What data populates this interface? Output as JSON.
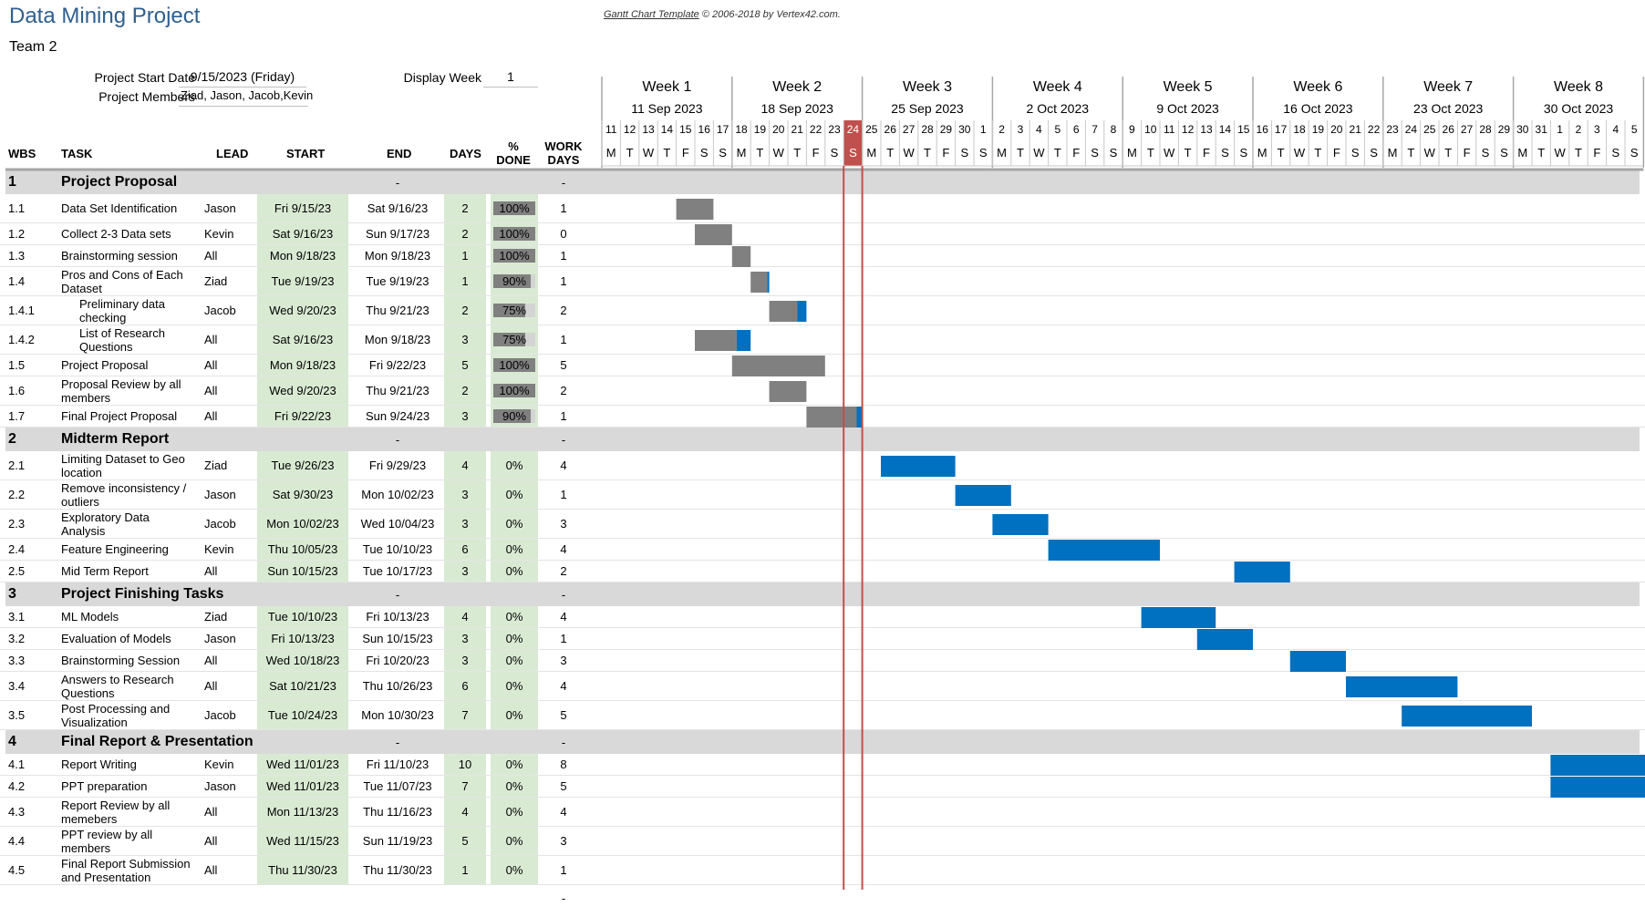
{
  "header": {
    "title": "Data Mining Project",
    "team": "Team 2",
    "credit_link": "Gantt Chart Template",
    "credit_rest": "© 2006-2018 by Vertex42.com."
  },
  "project": {
    "start_label": "Project Start Date",
    "start_value": "9/15/2023 (Friday)",
    "members_label": "Project Members",
    "members_value": "Ziad, Jason, Jacob,Kevin",
    "display_week_label": "Display Week",
    "display_week_value": "1"
  },
  "columns": {
    "wbs": "WBS",
    "task": "TASK",
    "lead": "LEAD",
    "start": "START",
    "end": "END",
    "days": "DAYS",
    "pct_done_1": "%",
    "pct_done_2": "DONE",
    "work_days_1": "WORK",
    "work_days_2": "DAYS"
  },
  "weeks": [
    {
      "label": "Week 1",
      "date": "11 Sep 2023"
    },
    {
      "label": "Week 2",
      "date": "18 Sep 2023"
    },
    {
      "label": "Week 3",
      "date": "25 Sep 2023"
    },
    {
      "label": "Week 4",
      "date": "2 Oct 2023"
    },
    {
      "label": "Week 5",
      "date": "9 Oct 2023"
    },
    {
      "label": "Week 6",
      "date": "16 Oct 2023"
    },
    {
      "label": "Week 7",
      "date": "23 Oct 2023"
    },
    {
      "label": "Week 8",
      "date": "30 Oct 2023"
    }
  ],
  "day_numbers": [
    "11",
    "12",
    "13",
    "14",
    "15",
    "16",
    "17",
    "18",
    "19",
    "20",
    "21",
    "22",
    "23",
    "24",
    "25",
    "26",
    "27",
    "28",
    "29",
    "30",
    "1",
    "2",
    "3",
    "4",
    "5",
    "6",
    "7",
    "8",
    "9",
    "10",
    "11",
    "12",
    "13",
    "14",
    "15",
    "16",
    "17",
    "18",
    "19",
    "20",
    "21",
    "22",
    "23",
    "24",
    "25",
    "26",
    "27",
    "28",
    "29",
    "30",
    "31",
    "1",
    "2",
    "3",
    "4",
    "5"
  ],
  "day_letters": [
    "M",
    "T",
    "W",
    "T",
    "F",
    "S",
    "S"
  ],
  "today_index": 13,
  "colors": {
    "title": "#2F5F8F",
    "bar_done": "#808080",
    "bar_todo": "#0070C0",
    "today": "#C0504D",
    "phase_band": "#D9D9D9",
    "green_cell": "#D9EAD3"
  },
  "phases": [
    {
      "wbs": "1",
      "name": "Project Proposal",
      "end": "-",
      "work_days": "-",
      "tasks": [
        {
          "wbs": "1.1",
          "task": "Data Set Identification",
          "lead": "Jason",
          "start": "Fri 9/15/23",
          "end": "Sat 9/16/23",
          "days": "2",
          "pct": "100%",
          "pct_value": 1.0,
          "work_days": "1",
          "bar": {
            "start": 4,
            "len": 2
          }
        },
        {
          "wbs": "1.2",
          "task": "Collect 2-3 Data sets",
          "lead": "Kevin",
          "start": "Sat 9/16/23",
          "end": "Sun 9/17/23",
          "days": "2",
          "pct": "100%",
          "pct_value": 1.0,
          "work_days": "0",
          "bar": {
            "start": 5,
            "len": 2
          }
        },
        {
          "wbs": "1.3",
          "task": "Brainstorming session",
          "lead": "All",
          "start": "Mon 9/18/23",
          "end": "Mon 9/18/23",
          "days": "1",
          "pct": "100%",
          "pct_value": 1.0,
          "work_days": "1",
          "bar": {
            "start": 7,
            "len": 1
          }
        },
        {
          "wbs": "1.4",
          "task": "Pros and Cons of Each Dataset",
          "lead": "Ziad",
          "start": "Tue 9/19/23",
          "end": "Tue 9/19/23",
          "days": "1",
          "pct": "90%",
          "pct_value": 0.9,
          "work_days": "1",
          "bar": {
            "start": 8,
            "len": 1
          }
        },
        {
          "wbs": "1.4.1",
          "task": "Preliminary data checking",
          "indent": true,
          "lead": "Jacob",
          "start": "Wed 9/20/23",
          "end": "Thu 9/21/23",
          "days": "2",
          "pct": "75%",
          "pct_value": 0.75,
          "work_days": "2",
          "bar": {
            "start": 9,
            "len": 2
          }
        },
        {
          "wbs": "1.4.2",
          "task": "List of Research Questions",
          "indent": true,
          "lead": "All",
          "start": "Sat 9/16/23",
          "end": "Mon 9/18/23",
          "days": "3",
          "pct": "75%",
          "pct_value": 0.75,
          "work_days": "1",
          "bar": {
            "start": 5,
            "len": 3
          }
        },
        {
          "wbs": "1.5",
          "task": "Project Proposal",
          "lead": "All",
          "start": "Mon 9/18/23",
          "end": "Fri 9/22/23",
          "days": "5",
          "pct": "100%",
          "pct_value": 1.0,
          "work_days": "5",
          "bar": {
            "start": 7,
            "len": 5
          }
        },
        {
          "wbs": "1.6",
          "task": "Proposal Review by all members",
          "lead": "All",
          "start": "Wed 9/20/23",
          "end": "Thu 9/21/23",
          "days": "2",
          "pct": "100%",
          "pct_value": 1.0,
          "work_days": "2",
          "bar": {
            "start": 9,
            "len": 2
          }
        },
        {
          "wbs": "1.7",
          "task": "Final Project Proposal",
          "lead": "All",
          "start": "Fri 9/22/23",
          "end": "Sun 9/24/23",
          "days": "3",
          "pct": "90%",
          "pct_value": 0.9,
          "work_days": "1",
          "bar": {
            "start": 11,
            "len": 3
          }
        }
      ]
    },
    {
      "wbs": "2",
      "name": "Midterm Report",
      "end": "-",
      "work_days": "-",
      "tasks": [
        {
          "wbs": "2.1",
          "task": "Limiting Dataset to Geo location",
          "lead": "Ziad",
          "start": "Tue 9/26/23",
          "end": "Fri 9/29/23",
          "days": "4",
          "pct": "0%",
          "pct_value": 0,
          "work_days": "4",
          "bar": {
            "start": 15,
            "len": 4
          }
        },
        {
          "wbs": "2.2",
          "task": "Remove inconsistency / outliers",
          "lead": "Jason",
          "start": "Sat 9/30/23",
          "end": "Mon 10/02/23",
          "days": "3",
          "pct": "0%",
          "pct_value": 0,
          "work_days": "1",
          "bar": {
            "start": 19,
            "len": 3
          }
        },
        {
          "wbs": "2.3",
          "task": "Exploratory Data Analysis",
          "lead": "Jacob",
          "start": "Mon 10/02/23",
          "end": "Wed 10/04/23",
          "days": "3",
          "pct": "0%",
          "pct_value": 0,
          "work_days": "3",
          "bar": {
            "start": 21,
            "len": 3
          }
        },
        {
          "wbs": "2.4",
          "task": "Feature Engineering",
          "lead": "Kevin",
          "start": "Thu 10/05/23",
          "end": "Tue 10/10/23",
          "days": "6",
          "pct": "0%",
          "pct_value": 0,
          "work_days": "4",
          "bar": {
            "start": 24,
            "len": 6
          }
        },
        {
          "wbs": "2.5",
          "task": "Mid Term Report",
          "lead": "All",
          "start": "Sun 10/15/23",
          "end": "Tue 10/17/23",
          "days": "3",
          "pct": "0%",
          "pct_value": 0,
          "work_days": "2",
          "bar": {
            "start": 34,
            "len": 3
          }
        }
      ]
    },
    {
      "wbs": "3",
      "name": "Project Finishing Tasks",
      "end": "-",
      "work_days": "-",
      "tasks": [
        {
          "wbs": "3.1",
          "task": "ML Models",
          "lead": "Ziad",
          "start": "Tue 10/10/23",
          "end": "Fri 10/13/23",
          "days": "4",
          "pct": "0%",
          "pct_value": 0,
          "work_days": "4",
          "bar": {
            "start": 29,
            "len": 4
          }
        },
        {
          "wbs": "3.2",
          "task": "Evaluation of Models",
          "lead": "Jason",
          "start": "Fri 10/13/23",
          "end": "Sun 10/15/23",
          "days": "3",
          "pct": "0%",
          "pct_value": 0,
          "work_days": "1",
          "bar": {
            "start": 32,
            "len": 3
          }
        },
        {
          "wbs": "3.3",
          "task": "Brainstorming Session",
          "lead": "All",
          "start": "Wed 10/18/23",
          "end": "Fri 10/20/23",
          "days": "3",
          "pct": "0%",
          "pct_value": 0,
          "work_days": "3",
          "bar": {
            "start": 37,
            "len": 3
          }
        },
        {
          "wbs": "3.4",
          "task": "Answers to Research Questions",
          "lead": "All",
          "start": "Sat 10/21/23",
          "end": "Thu 10/26/23",
          "days": "6",
          "pct": "0%",
          "pct_value": 0,
          "work_days": "4",
          "bar": {
            "start": 40,
            "len": 6
          }
        },
        {
          "wbs": "3.5",
          "task": "Post Processing and Visualization",
          "lead": "Jacob",
          "start": "Tue 10/24/23",
          "end": "Mon 10/30/23",
          "days": "7",
          "pct": "0%",
          "pct_value": 0,
          "work_days": "5",
          "bar": {
            "start": 43,
            "len": 7
          }
        }
      ]
    },
    {
      "wbs": "4",
      "name": "Final Report & Presentation",
      "end": "-",
      "work_days": "-",
      "tasks": [
        {
          "wbs": "4.1",
          "task": "Report Writing",
          "lead": "Kevin",
          "start": "Wed 11/01/23",
          "end": "Fri 11/10/23",
          "days": "10",
          "pct": "0%",
          "pct_value": 0,
          "work_days": "8",
          "bar": {
            "start": 51,
            "len": 10
          }
        },
        {
          "wbs": "4.2",
          "task": "PPT preparation",
          "lead": "Jason",
          "start": "Wed 11/01/23",
          "end": "Tue 11/07/23",
          "days": "7",
          "pct": "0%",
          "pct_value": 0,
          "work_days": "5",
          "bar": {
            "start": 51,
            "len": 7
          }
        },
        {
          "wbs": "4.3",
          "task": "Report Review by all memebers",
          "lead": "All",
          "start": "Mon 11/13/23",
          "end": "Thu 11/16/23",
          "days": "4",
          "pct": "0%",
          "pct_value": 0,
          "work_days": "4",
          "bar": null
        },
        {
          "wbs": "4.4",
          "task": "PPT review by all members",
          "lead": "All",
          "start": "Wed 11/15/23",
          "end": "Sun 11/19/23",
          "days": "5",
          "pct": "0%",
          "pct_value": 0,
          "work_days": "3",
          "bar": null
        },
        {
          "wbs": "4.5",
          "task": "Final Report Submission and Presentation",
          "lead": "All",
          "start": "Thu 11/30/23",
          "end": "Thu 11/30/23",
          "days": "1",
          "pct": "0%",
          "pct_value": 0,
          "work_days": "1",
          "bar": null
        }
      ]
    }
  ],
  "trailing_dash": "-"
}
